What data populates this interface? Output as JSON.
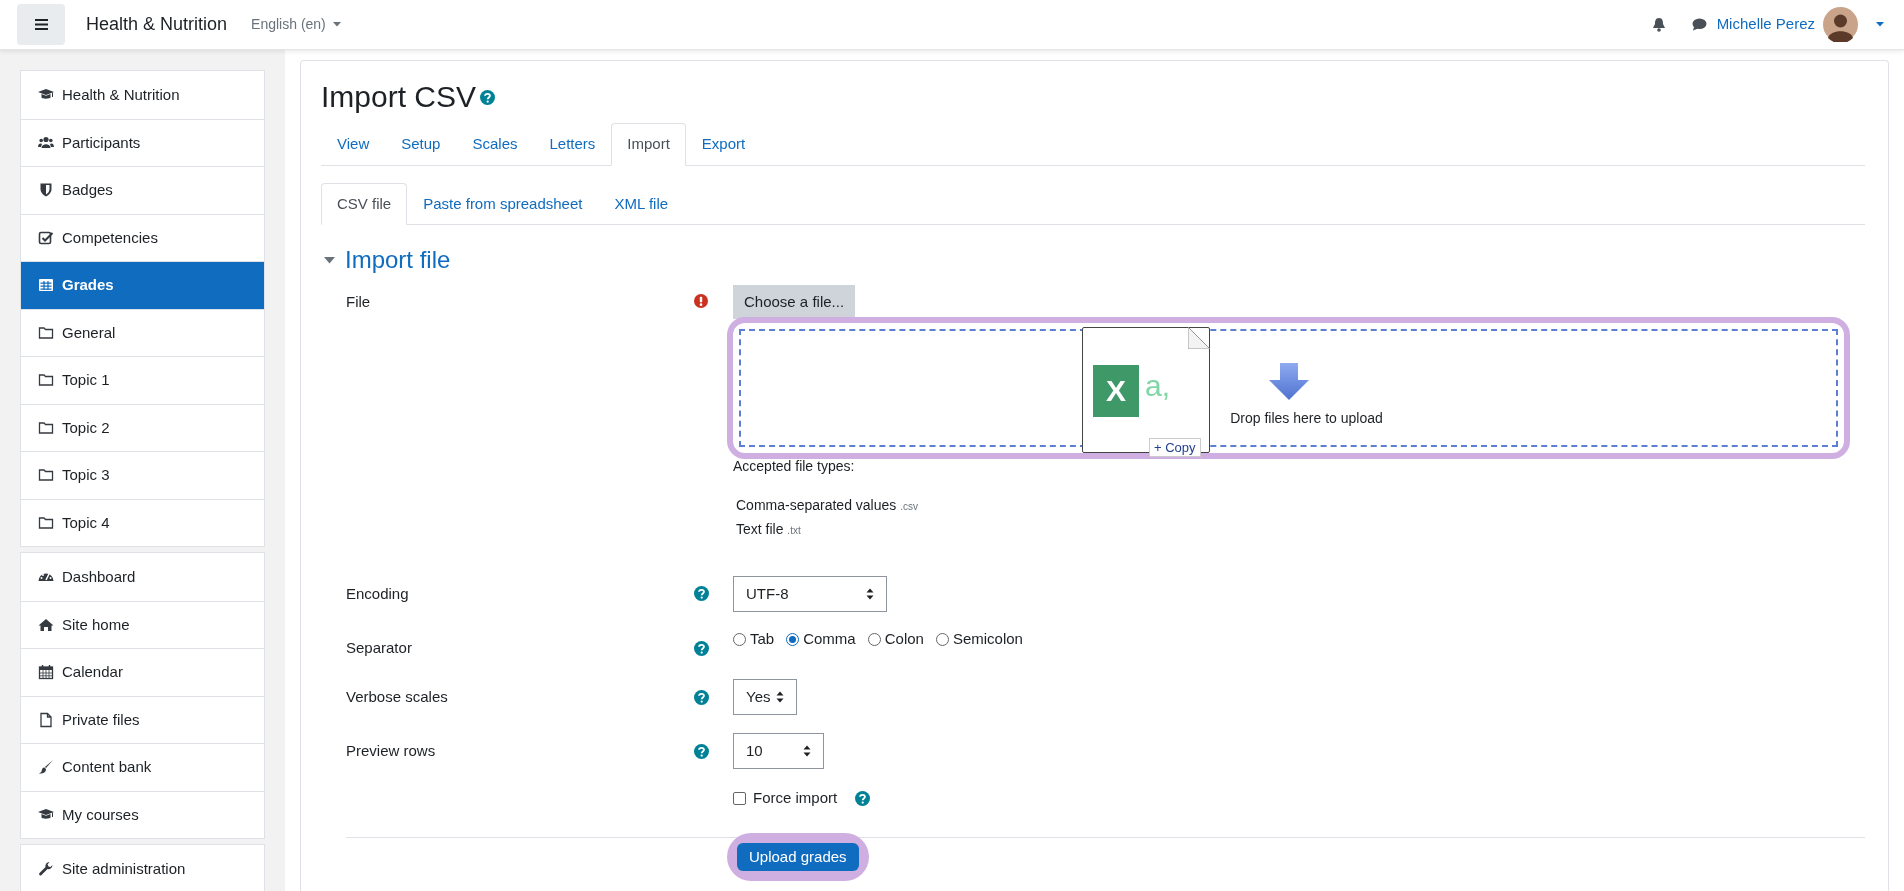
{
  "navbar": {
    "site_name": "Health & Nutrition",
    "language": "English (en)",
    "user_name": "Michelle Perez"
  },
  "sidebar": {
    "groups": [
      {
        "items": [
          {
            "label": "Health & Nutrition",
            "selected": false
          },
          {
            "label": "Participants",
            "selected": false
          },
          {
            "label": "Badges",
            "selected": false
          },
          {
            "label": "Competencies",
            "selected": false
          },
          {
            "label": "Grades",
            "selected": true
          },
          {
            "label": "General",
            "selected": false
          },
          {
            "label": "Topic 1",
            "selected": false
          },
          {
            "label": "Topic 2",
            "selected": false
          },
          {
            "label": "Topic 3",
            "selected": false
          },
          {
            "label": "Topic 4",
            "selected": false
          }
        ]
      },
      {
        "items": [
          {
            "label": "Dashboard",
            "selected": false
          },
          {
            "label": "Site home",
            "selected": false
          },
          {
            "label": "Calendar",
            "selected": false
          },
          {
            "label": "Private files",
            "selected": false
          },
          {
            "label": "Content bank",
            "selected": false
          },
          {
            "label": "My courses",
            "selected": false
          }
        ]
      },
      {
        "items": [
          {
            "label": "Site administration",
            "selected": false
          }
        ]
      }
    ]
  },
  "page": {
    "title": "Import CSV",
    "tabs": [
      {
        "label": "View",
        "selected": false
      },
      {
        "label": "Setup",
        "selected": false
      },
      {
        "label": "Scales",
        "selected": false
      },
      {
        "label": "Letters",
        "selected": false
      },
      {
        "label": "Import",
        "selected": true
      },
      {
        "label": "Export",
        "selected": false
      }
    ],
    "subtabs": [
      {
        "label": "CSV file",
        "selected": true
      },
      {
        "label": "Paste from spreadsheet",
        "selected": false
      },
      {
        "label": "XML file",
        "selected": false
      }
    ]
  },
  "section": {
    "title": "Import file"
  },
  "file_field": {
    "label": "File",
    "required": true,
    "button": "Choose a file...",
    "highlighted": true,
    "drop_text": "Drop files here to upload",
    "drag_preview": {
      "letter": "X",
      "sample": "a,",
      "badge": "+ Copy"
    },
    "accepted_title": "Accepted file types:",
    "accepted_types": [
      {
        "name": "Comma-separated values",
        "ext": ".csv"
      },
      {
        "name": "Text file",
        "ext": ".txt"
      }
    ]
  },
  "fields": [
    {
      "kind": "select",
      "label": "Encoding",
      "value": "UTF-8"
    },
    {
      "kind": "radio",
      "label": "Separator",
      "options": [
        {
          "label": "Tab",
          "selected": false
        },
        {
          "label": "Comma",
          "selected": true
        },
        {
          "label": "Colon",
          "selected": false
        },
        {
          "label": "Semicolon",
          "selected": false
        }
      ]
    },
    {
      "kind": "select",
      "label": "Verbose scales",
      "value": "Yes"
    },
    {
      "kind": "select",
      "label": "Preview rows",
      "value": "10"
    },
    {
      "kind": "checkbox",
      "label": "Force import",
      "checked": false
    }
  ],
  "submit": {
    "label": "Upload grades",
    "highlighted": true
  }
}
